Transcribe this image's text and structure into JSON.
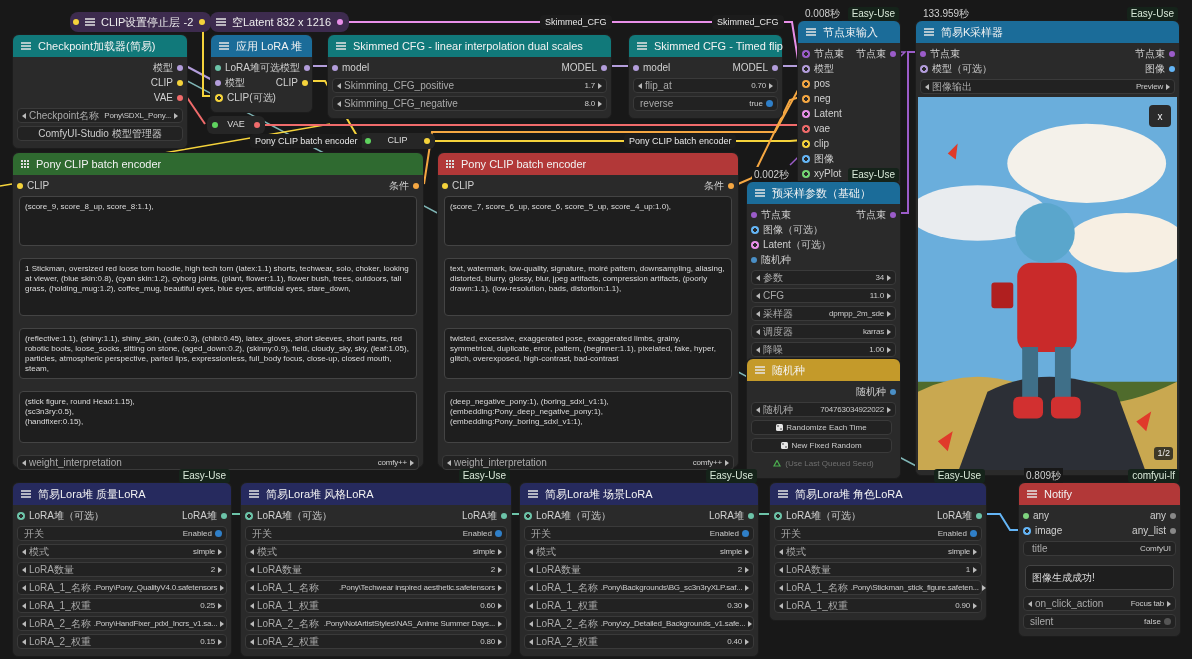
{
  "nodes": [
    {
      "kind": "collapsed",
      "title": "CLIP设置停止层 -2",
      "color": "#3d2b4e",
      "inputs": [
        {
          "color": "#f5d33b"
        }
      ],
      "outputs": [
        {
          "color": "#f5d33b"
        }
      ]
    },
    {
      "kind": "collapsed",
      "title": "空Latent 832 x 1216",
      "color": "#3d2b4e",
      "outputs": [
        {
          "color": "#e88fe8"
        }
      ]
    },
    {
      "kind": "node",
      "title": "Checkpoint加载器(简易)",
      "color": "#11797a",
      "outputs": [
        {
          "label": "模型",
          "color": "#b39ddb"
        },
        {
          "label": "CLIP",
          "color": "#f5d33b"
        },
        {
          "label": "VAE",
          "color": "#f06b6b"
        }
      ],
      "widgets": [
        {
          "kind": "combo",
          "label": "Checkpoint名称",
          "value": "Pony\\SDXL_Pony..."
        },
        {
          "kind": "button",
          "label": "ComfyUI-Studio 模型管理器"
        }
      ]
    },
    {
      "kind": "node",
      "title": "应用 LoRA 堆",
      "color": "#1b6c99",
      "inputs": [
        {
          "label": "LoRA堆可选",
          "color": "#6cc3a8"
        },
        {
          "label": "模型",
          "color": "#b39ddb"
        },
        {
          "label": "CLIP(可选)",
          "color": "#f5d33b",
          "optional": true
        }
      ],
      "outputs": [
        {
          "label": "模型",
          "color": "#b39ddb"
        },
        {
          "label": "CLIP",
          "color": "#f5d33b"
        }
      ]
    },
    {
      "kind": "node",
      "title": "Skimmed CFG - linear interpolation dual scales",
      "color": "#11797a",
      "inputs": [
        {
          "label": "model",
          "color": "#b39ddb"
        }
      ],
      "outputs": [
        {
          "label": "MODEL",
          "color": "#b39ddb"
        }
      ],
      "widgets": [
        {
          "kind": "combo",
          "label": "Skimming_CFG_positive",
          "value": "1.7"
        },
        {
          "kind": "combo",
          "label": "Skimming_CFG_negative",
          "value": "8.0"
        }
      ]
    },
    {
      "kind": "node",
      "title": "Skimmed CFG - Timed flip",
      "color": "#11797a",
      "inputs": [
        {
          "label": "model",
          "color": "#b39ddb"
        }
      ],
      "outputs": [
        {
          "label": "MODEL",
          "color": "#b39ddb"
        }
      ],
      "widgets": [
        {
          "kind": "combo",
          "label": "flip_at",
          "value": "0.70"
        },
        {
          "kind": "toggle",
          "label": "reverse",
          "value": "true",
          "on": true
        }
      ]
    },
    {
      "kind": "node",
      "title": "节点束输入",
      "color": "#1b6c99",
      "time": "0.008秒",
      "badge": "Easy-Use",
      "inputs": [
        {
          "label": "节点束",
          "color": "#9b5cc9",
          "optional": true
        },
        {
          "label": "模型",
          "color": "#b39ddb",
          "optional": true
        },
        {
          "label": "pos",
          "color": "#f5a742",
          "optional": true
        },
        {
          "label": "neg",
          "color": "#f5a742",
          "optional": true
        },
        {
          "label": "Latent",
          "color": "#e88fe8",
          "optional": true
        },
        {
          "label": "vae",
          "color": "#f06b6b",
          "optional": true
        },
        {
          "label": "clip",
          "color": "#f5d33b",
          "optional": true
        },
        {
          "label": "图像",
          "color": "#64b5f6",
          "optional": true
        },
        {
          "label": "xyPlot",
          "color": "#72d572",
          "optional": true
        }
      ],
      "outputs": [
        {
          "label": "节点束",
          "color": "#9b5cc9"
        }
      ]
    },
    {
      "kind": "node",
      "title": "简易K采样器",
      "color": "#1b6c99",
      "time": "133.959秒",
      "badge": "Easy-Use",
      "inputs": [
        {
          "label": "节点束",
          "color": "#9b5cc9"
        },
        {
          "label": "模型（可选）",
          "color": "#b39ddb",
          "optional": true
        }
      ],
      "outputs": [
        {
          "label": "节点束",
          "color": "#9b5cc9"
        },
        {
          "label": "图像",
          "color": "#64b5f6"
        }
      ],
      "widgets": [
        {
          "kind": "combo",
          "label": "图像输出",
          "value": "Preview"
        },
        {
          "counter": "1/2",
          "close": "x"
        }
      ]
    },
    {
      "kind": "reroute",
      "title": "VAE",
      "inputs": [
        {
          "color": "#5fd35f"
        }
      ],
      "outputs": [
        {
          "color": "#f06b6b"
        }
      ]
    },
    {
      "kind": "reroute",
      "title": "CLIP",
      "inputs": [
        {
          "color": "#5fd35f"
        }
      ],
      "outputs": [
        {
          "color": "#f5d33b"
        }
      ]
    },
    {
      "kind": "node",
      "title": "Pony CLIP batch encoder",
      "color": "#2f6a30",
      "grip": true,
      "inputs": [
        {
          "label": "CLIP",
          "color": "#f5d33b"
        }
      ],
      "outputs": [
        {
          "label": "条件",
          "color": "#f5a742"
        }
      ],
      "widgets": [
        {
          "kind": "textarea",
          "text": "(score_9, score_8_up, score_8:1.1),"
        },
        {
          "kind": "textarea",
          "text": "1 Stickman, oversized red loose torn hoodie, high tech torn (latex:1.1) shorts, techwear, solo, choker, looking at viewer, (blue skin:0.8), (cyan skin:1.2), cyborg joints, (plant, flower:1.1), flower bush, trees, outdoors, tall grass, (holding_mug:1.2), coffee_mug, beautiful eyes, blue eyes, artificial eyes, stare_down,"
        },
        {
          "kind": "textarea",
          "text": "(reflective:1.1), (shiny:1.1), shiny_skin, (cute:0.3), (chibi:0.45), latex_gloves, short sleeves, short pants, red robotic boots, loose_socks, sitting on stone, (aged_down:0.2), (skinny:0.9), field, cloudy_sky, sky, (leaf:1.05), particles, atmospheric perspective, parted lips, expressionless, full_body focus, close-up, closed mouth, steam,"
        },
        {
          "kind": "textarea",
          "text": "(stick figure, round Head:1.15),\n(sc3n3ry:0.5),\n(handfixer:0.15),"
        },
        {
          "kind": "combo",
          "label": "weight_interpretation",
          "value": "comfy++"
        }
      ]
    },
    {
      "kind": "node",
      "title": "Pony CLIP batch encoder",
      "color": "#b23838",
      "grip": true,
      "inputs": [
        {
          "label": "CLIP",
          "color": "#f5d33b"
        }
      ],
      "outputs": [
        {
          "label": "条件",
          "color": "#f5a742"
        }
      ],
      "widgets": [
        {
          "kind": "textarea",
          "text": "(score_7, score_6_up, score_6, score_5_up, score_4_up:1.0),"
        },
        {
          "kind": "textarea",
          "text": "text, watermark, low-quality, signature, moiré pattern, downsampling, aliasing, distorted, blurry, glossy, blur, jpeg artifacts, compression artifacts, (poorly drawn:1.1), (low-resolution, bads, distortion:1.1),"
        },
        {
          "kind": "textarea",
          "text": "twisted, excessive, exaggerated pose, exaggerated limbs, grainy, symmetrical, duplicate, error, pattern, (beginner:1.1), pixelated, fake, hyper, glitch, overexposed, high-contrast, bad-contrast"
        },
        {
          "kind": "textarea",
          "text": "(deep_negative_pony:1), (boring_sdxl_v1:1),\n(embedding:Pony_deep_negative_pony:1),\n(embedding:Pony_boring_sdxl_v1:1),"
        },
        {
          "kind": "combo",
          "label": "weight_interpretation",
          "value": "comfy++"
        }
      ]
    },
    {
      "kind": "node",
      "title": "预采样参数（基础）",
      "color": "#1b6c99",
      "time": "0.002秒",
      "badge": "Easy-Use",
      "inputs": [
        {
          "label": "节点束",
          "color": "#9b5cc9"
        },
        {
          "label": "图像（可选）",
          "color": "#64b5f6",
          "optional": true
        },
        {
          "label": "Latent（可选）",
          "color": "#e88fe8",
          "optional": true
        },
        {
          "label": "随机种",
          "color": "#4a8fc6"
        }
      ],
      "outputs": [
        {
          "label": "节点束",
          "color": "#9b5cc9"
        }
      ],
      "widgets": [
        {
          "kind": "combo",
          "label": "参数",
          "value": "34"
        },
        {
          "kind": "combo",
          "label": "CFG",
          "value": "11.0"
        },
        {
          "kind": "combo",
          "label": "采样器",
          "value": "dpmpp_2m_sde"
        },
        {
          "kind": "combo",
          "label": "调度器",
          "value": "karras"
        },
        {
          "kind": "combo",
          "label": "降噪",
          "value": "1.00"
        }
      ]
    },
    {
      "kind": "node",
      "title": "随机种",
      "color": "#c49a2a",
      "outputs": [
        {
          "label": "随机种",
          "color": "#4a8fc6"
        }
      ],
      "widgets": [
        {
          "kind": "combo",
          "label": "随机种",
          "value": "704763034922022"
        },
        {
          "kind": "dice_button",
          "label": "Randomize Each Time"
        },
        {
          "kind": "dice_button",
          "label": "New Fixed Random"
        },
        {
          "kind": "reuse_button",
          "label": "(Use Last Queued Seed)",
          "disabled": true
        }
      ]
    },
    {
      "kind": "node",
      "title": "简易Lora堆 质量LoRA",
      "color": "#262a5e",
      "badge": "Easy-Use",
      "inputs": [
        {
          "label": "LoRA堆（可选）",
          "color": "#6cc3a8",
          "optional": true
        }
      ],
      "outputs": [
        {
          "label": "LoRA堆",
          "color": "#6cc3a8"
        }
      ],
      "widgets": [
        {
          "kind": "toggle",
          "label": "开关",
          "value": "Enabled",
          "on": true
        },
        {
          "kind": "combo",
          "label": "模式",
          "value": "simple"
        },
        {
          "kind": "combo",
          "label": "LoRA数量",
          "value": "2"
        },
        {
          "kind": "combo",
          "label": "LoRA_1_名称",
          "value": ".Pony\\Pony_QualityV4.0.safetensors"
        },
        {
          "kind": "combo",
          "label": "LoRA_1_权重",
          "value": "0.25"
        },
        {
          "kind": "combo",
          "label": "LoRA_2_名称",
          "value": ".Pony\\HandFixer_pdxl_Incrs_v1.sa..."
        },
        {
          "kind": "combo",
          "label": "LoRA_2_权重",
          "value": "0.15"
        }
      ]
    },
    {
      "kind": "node",
      "title": "简易Lora堆 风格LoRA",
      "color": "#262a5e",
      "badge": "Easy-Use",
      "inputs": [
        {
          "label": "LoRA堆（可选）",
          "color": "#6cc3a8",
          "optional": true
        }
      ],
      "outputs": [
        {
          "label": "LoRA堆",
          "color": "#6cc3a8"
        }
      ],
      "widgets": [
        {
          "kind": "toggle",
          "label": "开关",
          "value": "Enabled",
          "on": true
        },
        {
          "kind": "combo",
          "label": "模式",
          "value": "simple"
        },
        {
          "kind": "combo",
          "label": "LoRA数量",
          "value": "2"
        },
        {
          "kind": "combo",
          "label": "LoRA_1_名称",
          "value": ".Pony\\Techwear inspired aesthetic.safetensors"
        },
        {
          "kind": "combo",
          "label": "LoRA_1_权重",
          "value": "0.60"
        },
        {
          "kind": "combo",
          "label": "LoRA_2_名称",
          "value": ".Pony\\NotArtistStyles\\NAS_Anime Summer Days..."
        },
        {
          "kind": "combo",
          "label": "LoRA_2_权重",
          "value": "0.80"
        }
      ]
    },
    {
      "kind": "node",
      "title": "简易Lora堆 场景LoRA",
      "color": "#262a5e",
      "badge": "Easy-Use",
      "inputs": [
        {
          "label": "LoRA堆（可选）",
          "color": "#6cc3a8",
          "optional": true
        }
      ],
      "outputs": [
        {
          "label": "LoRA堆",
          "color": "#6cc3a8"
        }
      ],
      "widgets": [
        {
          "kind": "toggle",
          "label": "开关",
          "value": "Enabled",
          "on": true
        },
        {
          "kind": "combo",
          "label": "模式",
          "value": "simple"
        },
        {
          "kind": "combo",
          "label": "LoRA数量",
          "value": "2"
        },
        {
          "kind": "combo",
          "label": "LoRA_1_名称",
          "value": ".Pony\\Backgrounds\\BG_sc3n3ryXLP.saf..."
        },
        {
          "kind": "combo",
          "label": "LoRA_1_权重",
          "value": "0.30"
        },
        {
          "kind": "combo",
          "label": "LoRA_2_名称",
          "value": ".Pony\\zy_Detailed_Backgrounds_v1.safe..."
        },
        {
          "kind": "combo",
          "label": "LoRA_2_权重",
          "value": "0.40"
        }
      ]
    },
    {
      "kind": "node",
      "title": "简易Lora堆 角色LoRA",
      "color": "#262a5e",
      "badge": "Easy-Use",
      "inputs": [
        {
          "label": "LoRA堆（可选）",
          "color": "#6cc3a8",
          "optional": true
        }
      ],
      "outputs": [
        {
          "label": "LoRA堆",
          "color": "#6cc3a8"
        }
      ],
      "widgets": [
        {
          "kind": "toggle",
          "label": "开关",
          "value": "Enabled",
          "on": true
        },
        {
          "kind": "combo",
          "label": "模式",
          "value": "simple"
        },
        {
          "kind": "combo",
          "label": "LoRA数量",
          "value": "1"
        },
        {
          "kind": "combo",
          "label": "LoRA_1_名称",
          "value": ".Pony\\Stickman_stick_figure.safeten..."
        },
        {
          "kind": "combo",
          "label": "LoRA_1_权重",
          "value": "0.90"
        }
      ]
    },
    {
      "kind": "node",
      "title": "Notify",
      "color": "#b23838",
      "time": "0.809秒",
      "badge": "comfyui-lf",
      "inputs": [
        {
          "label": "any",
          "color": "#7ed37e"
        },
        {
          "label": "image",
          "color": "#64b5f6",
          "optional": true
        }
      ],
      "outputs": [
        {
          "label": "any",
          "color": "#888888"
        },
        {
          "label": "any_list",
          "color": "#888888"
        }
      ],
      "widgets": [
        {
          "kind": "text",
          "label": "title",
          "value": "ComfyUI"
        },
        {
          "kind": "note",
          "text": "图像生成成功!"
        },
        {
          "kind": "combo",
          "label": "on_click_action",
          "value": "Focus tab"
        },
        {
          "kind": "toggle",
          "label": "silent",
          "value": "false",
          "on": false
        }
      ]
    }
  ],
  "link_labels": [
    "Skimmed_CFG",
    "Skimmed_CFG",
    "Pony CLIP batch encoder",
    "Pony CLIP batch encoder"
  ]
}
